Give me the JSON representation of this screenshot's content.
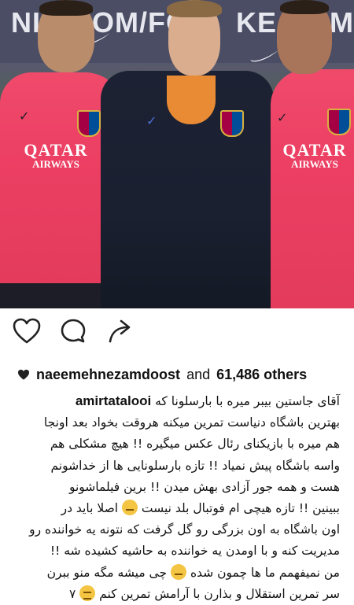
{
  "photo": {
    "banner_text_left": "NIK.COM/FCB",
    "banner_text_right": "KE.COM",
    "jersey_sponsor_line1": "QATAR",
    "jersey_sponsor_line2": "AIRWAYS"
  },
  "actions": {
    "like_icon": "heart-outline-icon",
    "comment_icon": "comment-bubble-icon",
    "share_icon": "share-arrow-icon"
  },
  "likes": {
    "user": "naeemehnezamdoost",
    "and_text": "and",
    "others": "61,486 others"
  },
  "caption": {
    "username": "amirtatalooi",
    "line1": "آقای جاستین بیبر میره با بارسلونا که",
    "line2": "بهترین باشگاه دنیاست تمرین میکنه هروقت بخواد بعد اونجا",
    "line3": "هم میره با بازیکنای رئال عکس میگیره !! هیچ مشکلی هم",
    "line4": "واسه باشگاه پیش نمیاد !! تازه بارسلونایی ها از خداشونم",
    "line5": "هست و همه جور آزادی بهش میدن !! برین فیلماشونو",
    "line6a": "ببینین !! تازه هیچی ام فوتبال بلد نیست",
    "line6b": "اصلا باید در",
    "line7": "اون باشگاه به اون بزرگی رو گل گرفت که نتونه یه خواننده رو",
    "line8": "مدیریت کنه و با اومدن یه خواننده به حاشیه کشیده شه !!",
    "line9a": "من نمیفهمم ما ها چمون شده",
    "line9b": "چی میشه مگه منو ببرن",
    "line10a": "سر تمرین استقلال و بذارن با آرامش تمرین کنم",
    "line10b": "۷"
  }
}
